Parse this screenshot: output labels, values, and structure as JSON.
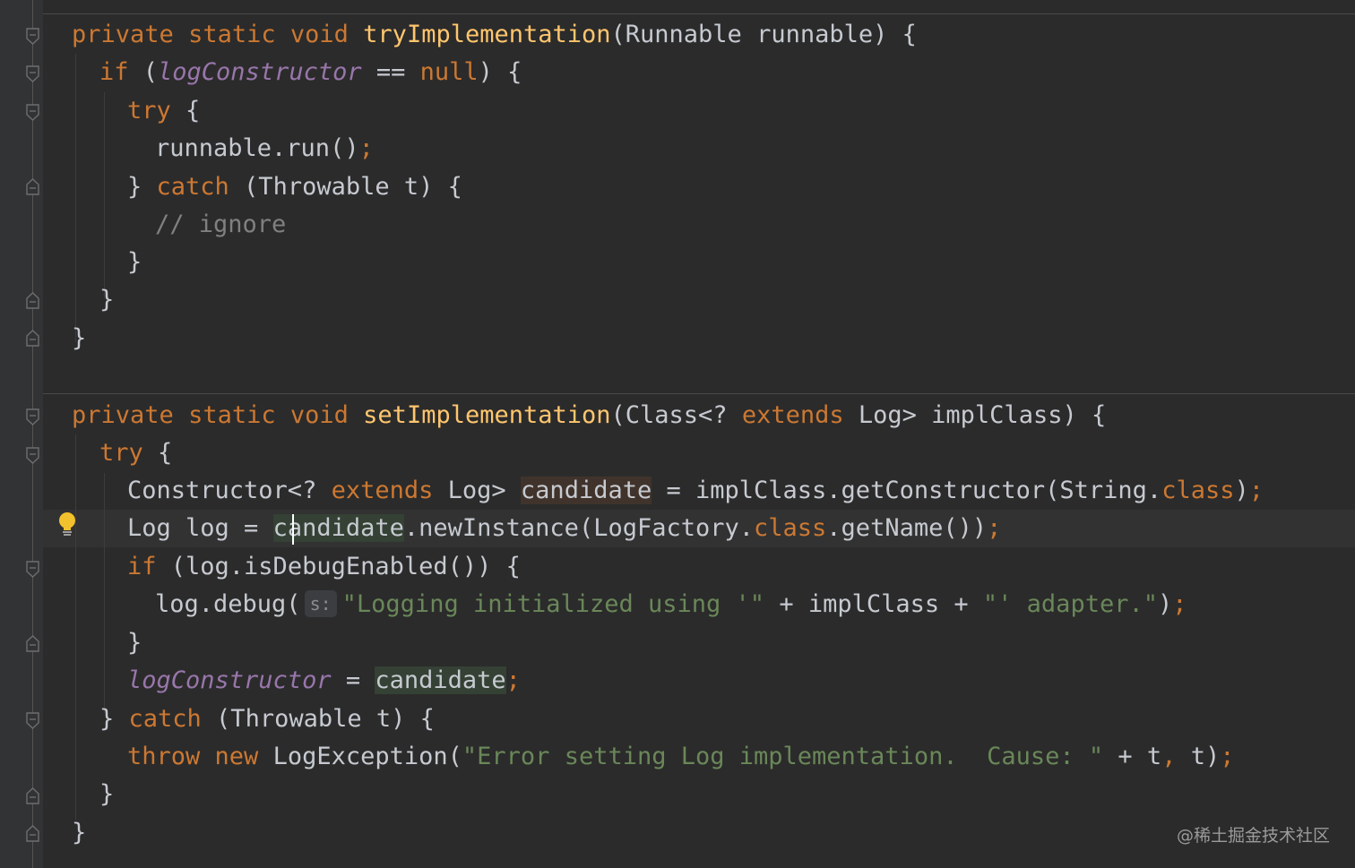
{
  "code": {
    "method1": {
      "signature": {
        "kw1": "private",
        "kw2": "static",
        "kw3": "void",
        "name": "tryImplementation",
        "params": "(Runnable runnable) {"
      },
      "if_kw": "if",
      "if_open": " (",
      "if_field": "logConstructor",
      "if_eq": " == ",
      "if_null": "null",
      "if_close": ") {",
      "try_kw": "try",
      "try_brace": " {",
      "run_call": "runnable.run()",
      "semicolon": ";",
      "catch_brace": "} ",
      "catch_kw": "catch",
      "catch_params": " (Throwable t) {",
      "comment": "// ignore",
      "close_brace": "}"
    },
    "method2": {
      "signature": {
        "kw1": "private",
        "kw2": "static",
        "kw3": "void",
        "name": "setImplementation",
        "params_a": "(Class<? ",
        "extends_kw": "extends",
        "params_b": " Log> implClass) {"
      },
      "try_kw": "try",
      "try_brace": " {",
      "ctor_a": "Constructor<? ",
      "ctor_extends": "extends",
      "ctor_b": " Log> ",
      "ctor_var": "candidate",
      "ctor_c": " = implClass.getConstructor(String.",
      "ctor_class": "class",
      "ctor_d": ")",
      "log_a": "Log log = ",
      "log_var": "candidate",
      "log_b": ".newInstance(LogFactory.",
      "log_class": "class",
      "log_c": ".getName())",
      "if_kw": "if",
      "if_rest": " (log.isDebugEnabled()) {",
      "debug_a": "log.debug(",
      "debug_hint": "s:",
      "debug_str1": "\"Logging initialized using '\"",
      "debug_b": " + implClass + ",
      "debug_str2": "\"' adapter.\"",
      "debug_c": ")",
      "assign_field": "logConstructor",
      "assign_eq": " = ",
      "assign_var": "candidate",
      "catch_close": "} ",
      "catch_kw": "catch",
      "catch_params": " (Throwable t) {",
      "throw_kw": "throw",
      "new_kw": "new",
      "throw_a": " LogException(",
      "throw_str": "\"Error setting Log implementation.  Cause: \"",
      "throw_b": " + t",
      "throw_comma": ",",
      "throw_c": " t)",
      "semicolon": ";",
      "close_brace": "}"
    }
  },
  "watermark": "@稀土掘金技术社区",
  "colors": {
    "background": "#2b2b2b",
    "keyword": "#cc7832",
    "function": "#ffc66d",
    "field": "#9876aa",
    "string": "#6a8759",
    "comment": "#808080",
    "text": "#c6cad0"
  },
  "icons": [
    "fold-marker-icon",
    "lightbulb-icon"
  ]
}
